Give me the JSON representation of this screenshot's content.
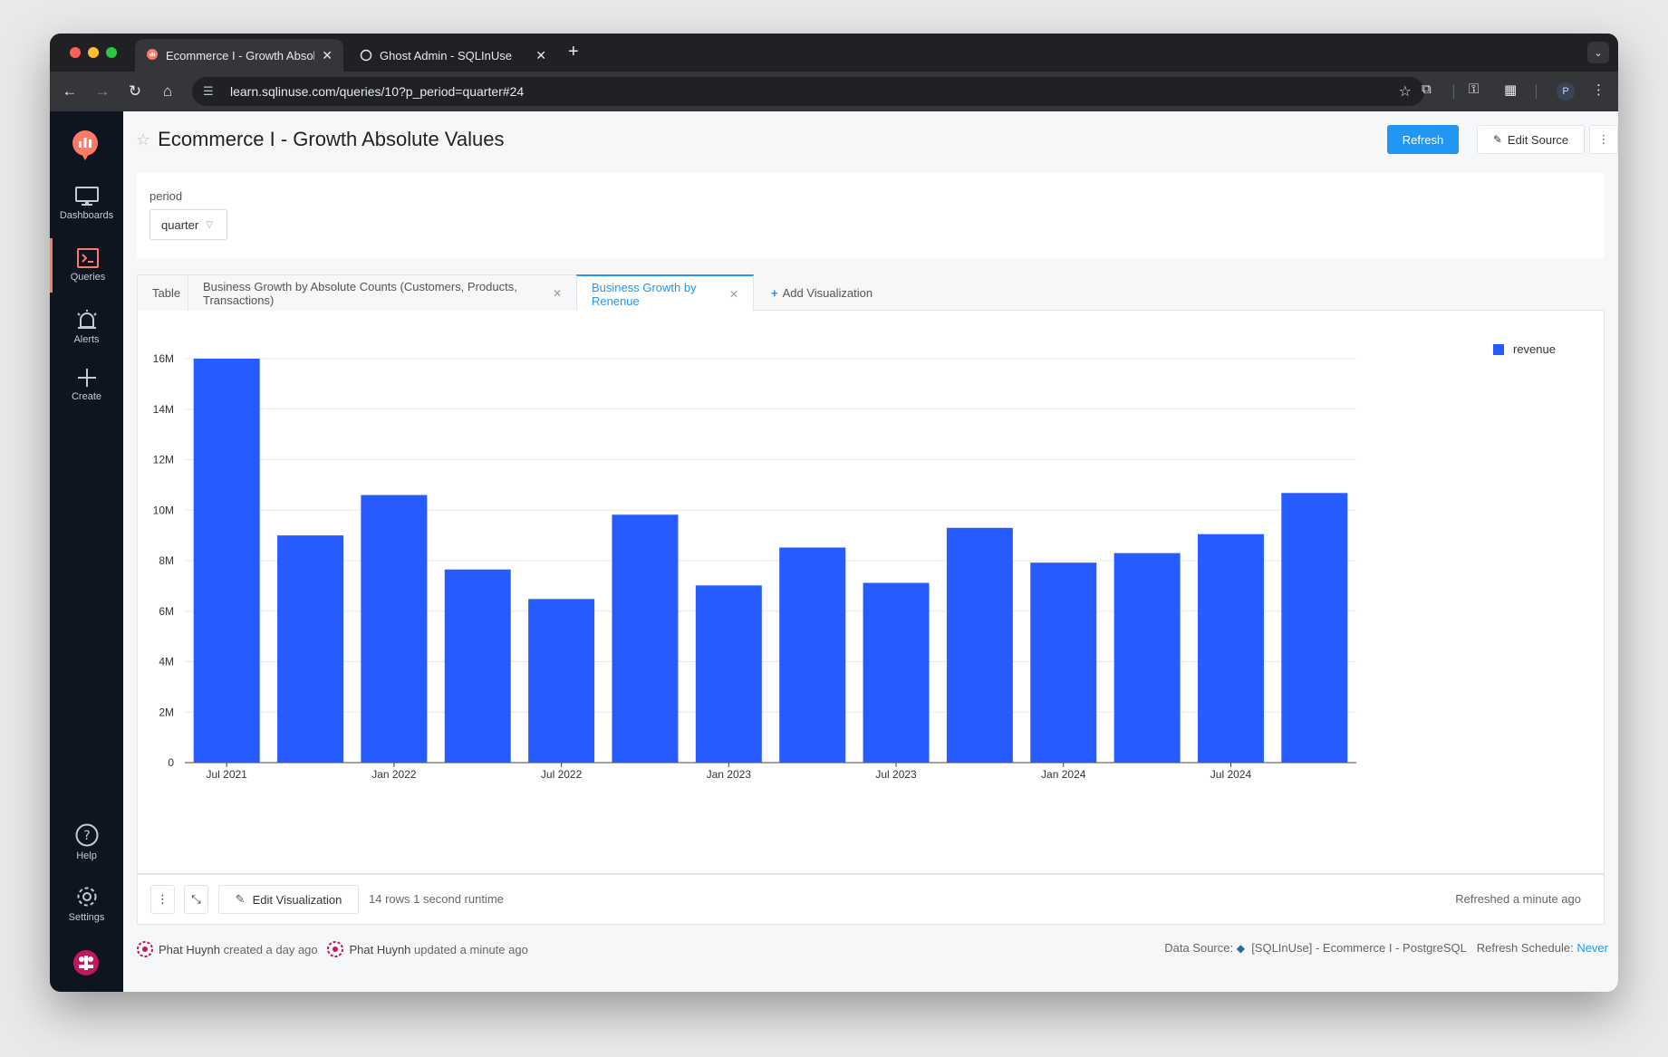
{
  "browser": {
    "tabs": [
      {
        "title": "Ecommerce I - Growth Absolu",
        "close": "✕"
      },
      {
        "title": "Ghost Admin - SQLInUse",
        "close": "✕"
      }
    ],
    "url": "learn.sqlinuse.com/queries/10?p_period=quarter#24",
    "profile_initial": "P"
  },
  "sidebar": {
    "items": [
      {
        "label": "Dashboards"
      },
      {
        "label": "Queries"
      },
      {
        "label": "Alerts"
      },
      {
        "label": "Create"
      },
      {
        "label": "Help"
      },
      {
        "label": "Settings"
      }
    ]
  },
  "header": {
    "title": "Ecommerce I - Growth Absolute Values",
    "refresh_label": "Refresh",
    "edit_source_label": "Edit Source"
  },
  "params": {
    "label": "period",
    "value": "quarter"
  },
  "viz_tabs": {
    "table": "Table",
    "counts": "Business Growth by Absolute Counts (Customers, Products, Transactions)",
    "revenue": "Business Growth by Renenue",
    "add": "Add Visualization"
  },
  "chart_data": {
    "type": "bar",
    "categories": [
      "2021-Q3",
      "2021-Q4",
      "2022-Q1",
      "2022-Q2",
      "2022-Q3",
      "2022-Q4",
      "2023-Q1",
      "2023-Q2",
      "2023-Q3",
      "2023-Q4",
      "2024-Q1",
      "2024-Q2",
      "2024-Q3",
      "2024-Q4"
    ],
    "series": [
      {
        "name": "revenue",
        "values": [
          16000000,
          9000000,
          10600000,
          7650000,
          6480000,
          9820000,
          7020000,
          8520000,
          7120000,
          9300000,
          7920000,
          8300000,
          9050000,
          10680000
        ]
      }
    ],
    "x_tick_labels": [
      "Jul 2021",
      "Jan 2022",
      "Jul 2022",
      "Jan 2023",
      "Jul 2023",
      "Jan 2024",
      "Jul 2024"
    ],
    "y_tick_labels": [
      "0",
      "2M",
      "4M",
      "6M",
      "8M",
      "10M",
      "12M",
      "14M",
      "16M"
    ],
    "ylim": [
      0,
      16000000
    ],
    "legend_position": "top-right",
    "bar_color": "#255bff",
    "grid": true
  },
  "footer": {
    "edit_viz_label": "Edit Visualization",
    "rows": "14 rows",
    "runtime": "1 second runtime",
    "refreshed": "Refreshed a minute ago"
  },
  "meta": {
    "creator": "Phat Huynh",
    "created": "created a day ago",
    "updater": "Phat Huynh",
    "updated": "updated a minute ago",
    "data_source_label": "Data Source:",
    "data_source": "[SQLInUse] - Ecommerce I - PostgreSQL",
    "schedule_label": "Refresh Schedule:",
    "schedule": "Never"
  }
}
